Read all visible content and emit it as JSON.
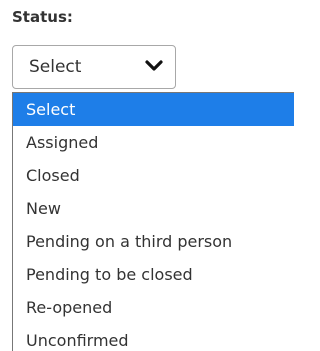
{
  "field": {
    "label": "Status:"
  },
  "select": {
    "value": "Select"
  },
  "dropdown": {
    "options": [
      "Select",
      "Assigned",
      "Closed",
      "New",
      "Pending on a third person",
      "Pending to be closed",
      "Re-opened",
      "Unconfirmed"
    ],
    "highlighted_option": "Select"
  },
  "colors": {
    "highlight": "#1e7ee8",
    "text": "#333333",
    "border": "#a8a8a8"
  },
  "icons": {
    "select_arrow": "chevron-down-icon"
  }
}
